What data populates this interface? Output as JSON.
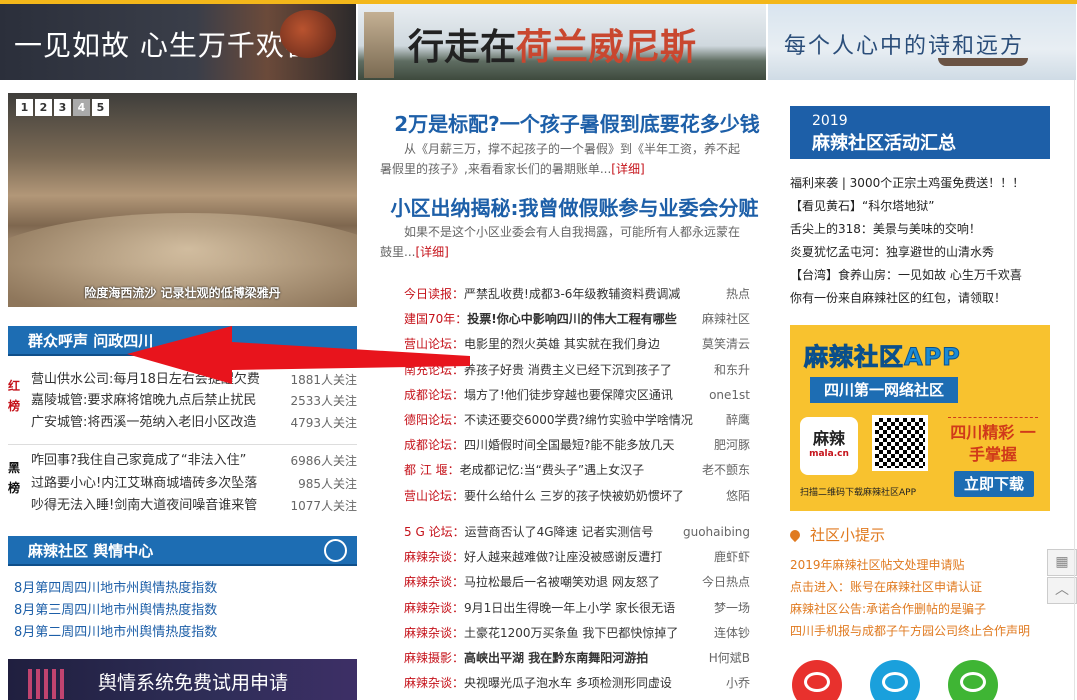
{
  "banners": {
    "b1": "一见如故 心生万千欢喜",
    "b2_pre": "行走在",
    "b2_hl": "荷兰威尼斯",
    "b3": "每个人心中的诗和远方"
  },
  "slider": {
    "pages": [
      "1",
      "2",
      "3",
      "4",
      "5"
    ],
    "active": "4",
    "caption": "险度海西流沙 记录壮观的低博梁雅丹"
  },
  "voice_section": {
    "title": "群众呼声 问政四川",
    "red_tag": "红榜",
    "red": [
      {
        "t": "营山供水公司:每月18日左右会提醒欠费",
        "n": "1881人关注"
      },
      {
        "t": "嘉陵城管:要求麻将馆晚九点后禁止扰民",
        "n": "2533人关注"
      },
      {
        "t": "广安城管:将西溪一苑纳入老旧小区改造",
        "n": "4793人关注"
      }
    ],
    "black_tag": "黑榜",
    "black": [
      {
        "t": "咋回事?我住自己家竟成了“非法入住”",
        "n": "6986人关注"
      },
      {
        "t": "过路要小心!内江艾琳商城墙砖多次坠落",
        "n": "985人关注"
      },
      {
        "t": "吵得无法入睡!剑南大道夜间噪音谁来管",
        "n": "1077人关注"
      }
    ]
  },
  "opinion_section": {
    "title": "麻辣社区 舆情中心",
    "items": [
      "8月第四周四川地市州舆情热度指数",
      "8月第三周四川地市州舆情热度指数",
      "8月第二周四川地市州舆情热度指数"
    ],
    "banner": "舆情系统免费试用申请"
  },
  "main": {
    "headline1": "2万是标配?一个孩子暑假到底要花多少钱",
    "summary1": "从《月薪三万，撑不起孩子的一个暑假》到《半年工资，养不起暑假里的孩子》,来看看家长们的暑期账单...",
    "more1": "[详细]",
    "headline2": "小区出纳揭秘:我曾做假账参与业委会分赃",
    "summary2": "如果不是这个小区业委会有人自我揭露，可能所有人都永远蒙在鼓里...",
    "more2": "[详细]"
  },
  "news1": [
    {
      "cat": "今日读报：",
      "ttl": "严禁乱收费!成都3-6年级教辅资料费调减",
      "src": "热点",
      "bold": false
    },
    {
      "cat": "建国70年：",
      "ttl": "投票!你心中影响四川的伟大工程有哪些",
      "src": "麻辣社区",
      "bold": true
    },
    {
      "cat": "营山论坛：",
      "ttl": "电影里的烈火英雄 其实就在我们身边",
      "src": "莫笑清云",
      "bold": false
    },
    {
      "cat": "南充论坛：",
      "ttl": "养孩子好贵 消费主义已经下沉到孩子了",
      "src": "和东升",
      "bold": false
    },
    {
      "cat": "成都论坛：",
      "ttl": "塌方了!他们徒步穿越也要保障灾区通讯",
      "src": "one1st",
      "bold": false
    },
    {
      "cat": "德阳论坛：",
      "ttl": "不读还要交6000学费?绵竹实验中学啥情况",
      "src": "醉鹰",
      "bold": false
    },
    {
      "cat": "成都论坛：",
      "ttl": "四川婚假时间全国最短?能不能多放几天",
      "src": "肥河豚",
      "bold": false
    },
    {
      "cat": "都 江 堰：",
      "ttl": "老成都记忆:当“费头子”遇上女汉子",
      "src": "老不颤东",
      "bold": false
    },
    {
      "cat": "营山论坛：",
      "ttl": "要什么给什么 三岁的孩子快被奶奶惯坏了",
      "src": "悠陌",
      "bold": false
    }
  ],
  "news2": [
    {
      "cat": "5 G 论坛：",
      "ttl": "运营商否认了4G降速 记者实测信号",
      "src": "guohaibing",
      "bold": false
    },
    {
      "cat": "麻辣杂谈：",
      "ttl": "好人越来越难做?让座没被感谢反遭打",
      "src": "鹿虾虾",
      "bold": false
    },
    {
      "cat": "麻辣杂谈：",
      "ttl": "马拉松最后一名被嘲笑劝退 网友怒了",
      "src": "今日热点",
      "bold": false
    },
    {
      "cat": "麻辣杂谈：",
      "ttl": "9月1日出生得晚一年上小学 家长很无语",
      "src": "梦一场",
      "bold": false
    },
    {
      "cat": "麻辣杂谈：",
      "ttl": "土豪花1200万买条鱼 我下巴都快惊掉了",
      "src": "连体钞",
      "bold": false
    },
    {
      "cat": "麻辣摄影：",
      "ttl": "高峡出平湖 我在黔东南舞阳河游拍",
      "src": "H何斌B",
      "bold": true
    },
    {
      "cat": "麻辣杂谈：",
      "ttl": "央视曝光瓜子泡水车 多项检测形同虚设",
      "src": "小乔",
      "bold": false
    }
  ],
  "events": {
    "year": "2019",
    "title": "麻辣社区活动汇总",
    "items": [
      "福利来袭 | 3000个正宗土鸡蛋免费送！！！",
      "【看见黄石】“科尔塔地狱”",
      "舌尖上的318：美景与美味的交响！",
      "炎夏犹忆孟屯河：独享避世的山清水秀",
      "【台湾】食养山房：一见如故 心生万千欢喜",
      "你有一份来自麻辣社区的红包，请领取！"
    ]
  },
  "app": {
    "title": "麻辣社区APP",
    "sub": "四川第一网络社区",
    "icon": "麻辣",
    "icon_sub": "mala.cn",
    "slogan": "四川精彩 一手掌握",
    "download": "立即下载",
    "scan": "扫描二维码下载麻辣社区APP"
  },
  "tips": {
    "title": "社区小提示",
    "items": [
      "2019年麻辣社区帖文处理申请贴",
      "点击进入：账号在麻辣社区申请认证",
      "麻辣社区公告:承诺合作删帖的是骗子",
      "四川手机报与成都子午方园公司终止合作声明"
    ]
  },
  "float": {
    "qr": "▦",
    "top": "︿"
  },
  "colors": {
    "accent_blue": "#1d5fa8",
    "accent_red": "#c5121a",
    "accent_orange": "#e07a20",
    "arrow": "#e8141c"
  }
}
